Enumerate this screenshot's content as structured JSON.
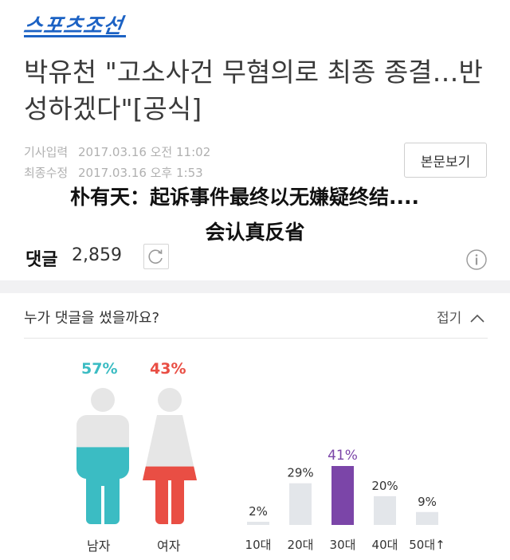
{
  "site": {
    "logo_text": "스포츠조선"
  },
  "article": {
    "headline": "박유천 \"고소사건 무혐의로 최종 종결…반성하겠다\"[공식]",
    "input_label": "기사입력",
    "input_time": "2017.03.16 오전 11:02",
    "edit_label": "최종수정",
    "edit_time": "2017.03.16 오후 1:53",
    "view_body_button": "본문보기"
  },
  "overlay_caption": {
    "line1": "朴有天：起诉事件最终以无嫌疑终结....",
    "line2": "会认真反省"
  },
  "comments": {
    "label": "댓글",
    "count": "2,859",
    "refresh_icon": "refresh-icon",
    "info_icon": "info-icon"
  },
  "stats_panel": {
    "title": "누가 댓글을 썼을까요?",
    "collapse_label": "접기",
    "male_pct_label": "57%",
    "female_pct_label": "43%",
    "male_label": "남자",
    "female_label": "여자",
    "male_fill": 0.57,
    "female_fill": 0.43,
    "colors": {
      "male": "#3bbcc3",
      "female": "#e94e44",
      "figure_bg": "#e6e6e6",
      "age_highlight": "#7b45a8",
      "age_bar": "#e3e6ea"
    }
  },
  "chart_data": {
    "type": "bar",
    "categories": [
      "10대",
      "20대",
      "30대",
      "40대",
      "50대↑"
    ],
    "values": [
      2,
      29,
      41,
      20,
      9
    ],
    "value_labels": [
      "2%",
      "29%",
      "41%",
      "20%",
      "9%"
    ],
    "highlight_index": 2,
    "ylim": [
      0,
      41
    ]
  }
}
